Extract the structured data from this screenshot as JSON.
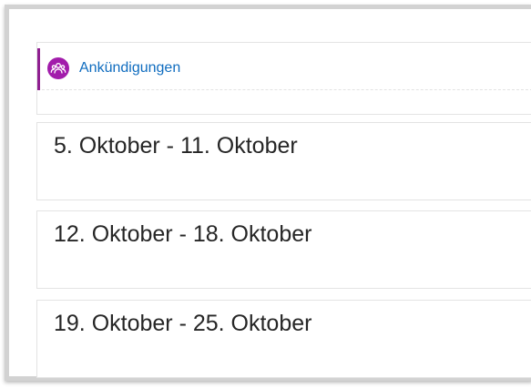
{
  "course": {
    "general_section": {
      "activity": {
        "icon": "forum-people-icon",
        "label": "Ankündigungen",
        "accent_color": "#8f1f90",
        "icon_color": "#a21cab",
        "link_color": "#0f6cbf"
      }
    },
    "weeks": [
      {
        "title": "5. Oktober - 11. Oktober"
      },
      {
        "title": "12. Oktober - 18. Oktober"
      },
      {
        "title": "19. Oktober - 25. Oktober"
      }
    ]
  }
}
